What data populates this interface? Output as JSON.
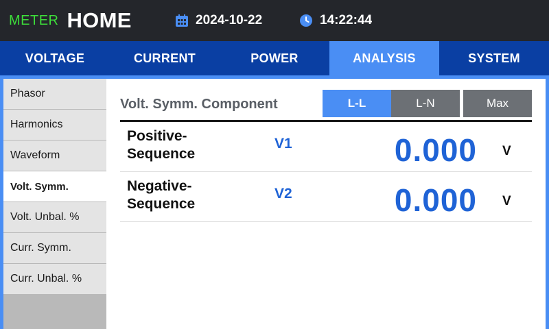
{
  "header": {
    "brand_prefix": "METER",
    "title": "HOME",
    "date": "2024-10-22",
    "time": "14:22:44",
    "date_icon": "calendar-icon",
    "time_icon": "clock-icon"
  },
  "tabs": [
    {
      "label": "VOLTAGE",
      "active": false
    },
    {
      "label": "CURRENT",
      "active": false
    },
    {
      "label": "POWER",
      "active": false
    },
    {
      "label": "ANALYSIS",
      "active": true
    },
    {
      "label": "SYSTEM",
      "active": false
    }
  ],
  "sidebar": {
    "items": [
      {
        "label": "Phasor",
        "active": false
      },
      {
        "label": "Harmonics",
        "active": false
      },
      {
        "label": "Waveform",
        "active": false
      },
      {
        "label": "Volt. Symm.",
        "active": true
      },
      {
        "label": "Volt. Unbal. %",
        "active": false
      },
      {
        "label": "Curr. Symm.",
        "active": false
      },
      {
        "label": "Curr. Unbal. %",
        "active": false
      }
    ]
  },
  "panel": {
    "title": "Volt. Symm. Component",
    "modes": [
      {
        "label": "L-L",
        "selected": true
      },
      {
        "label": "L-N",
        "selected": false
      },
      {
        "label": "Max",
        "selected": false
      }
    ],
    "rows": [
      {
        "label_line1": "Positive-",
        "label_line2": "Sequence",
        "symbol": "V1",
        "value": "0.000",
        "unit": "V"
      },
      {
        "label_line1": "Negative-",
        "label_line2": "Sequence",
        "symbol": "V2",
        "value": "0.000",
        "unit": "V"
      }
    ]
  },
  "colors": {
    "accent": "#4a8ef4",
    "tab_bar": "#0a3fa3",
    "brand_green": "#3ddc3a",
    "value_blue": "#1f63d6"
  }
}
